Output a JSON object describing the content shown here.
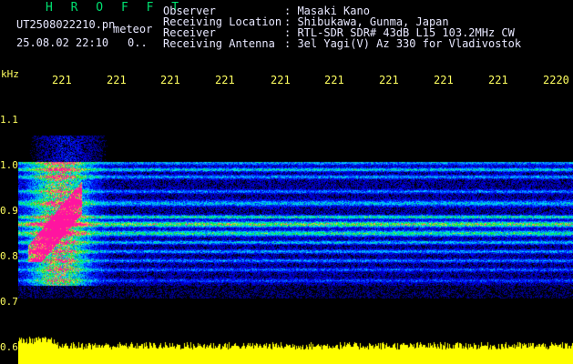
{
  "header": {
    "app_title": "H R O F F T",
    "filename": "UT2508022210.pn",
    "mode": "meteor",
    "datetime": "25.08.02 22:10",
    "counter": "0.."
  },
  "info": {
    "observer_label": "Observer",
    "observer_value": ": Masaki Kano",
    "location_label": "Receiving Location",
    "location_value": ": Shibukawa, Gunma, Japan",
    "receiver_label": "Receiver",
    "receiver_value": ": RTL-SDR SDR# 43dB L15 103.2MHz CW",
    "antenna_label": "Receiving Antenna",
    "antenna_value": ": 3el Yagi(V) Az 330 for Vladivostok"
  },
  "axes": {
    "unit": "kHz",
    "x_ticks": [
      "221",
      "221",
      "221",
      "221",
      "221",
      "221",
      "221",
      "221",
      "221",
      "2220"
    ],
    "y_ticks": [
      "1.1",
      "1.0",
      "0.9",
      "0.8",
      "0.7",
      "0.6"
    ]
  },
  "colors": {
    "background": "#000000",
    "label_text": "#ffff60",
    "info_text": "#e8e8ff",
    "title_text": "#00e070",
    "power_trace": "#ffff00"
  }
}
